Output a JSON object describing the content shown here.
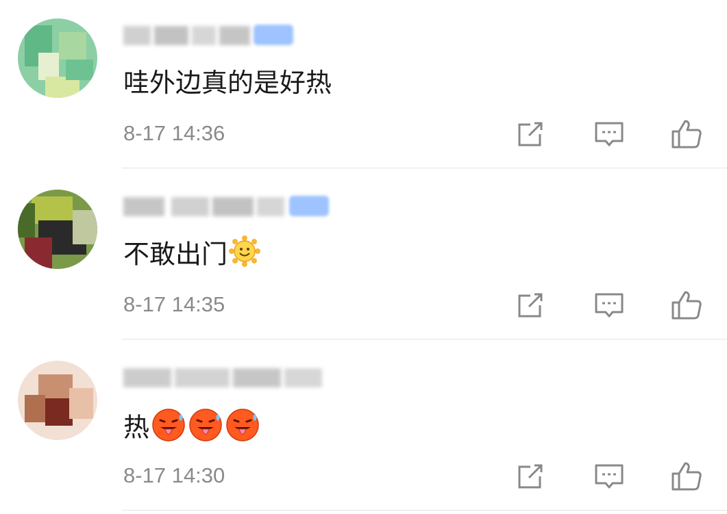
{
  "comments": [
    {
      "text": "哇外边真的是好热",
      "time": "8-17 14:36",
      "emojis": [],
      "avatar_colors": [
        "#7fc79a",
        "#5fb886",
        "#a8d8a0",
        "#d8e8a0",
        "#e6f0d0"
      ]
    },
    {
      "text": "不敢出门",
      "time": "8-17 14:35",
      "emojis": [
        "smiling-sun"
      ],
      "avatar_colors": [
        "#6a8a3a",
        "#2a2a2a",
        "#8a2a30",
        "#c0c8a0",
        "#4a6a2a"
      ]
    },
    {
      "text": "热",
      "time": "8-17 14:30",
      "emojis": [
        "hot-face",
        "hot-face",
        "hot-face"
      ],
      "avatar_colors": [
        "#f2d8c8",
        "#c89070",
        "#7a2a20",
        "#e8c0a8",
        "#b07050"
      ]
    }
  ],
  "colors": {
    "text": "#1a1a1a",
    "time": "#8a8a8a",
    "icon": "#888888",
    "divider": "#e3e3e3",
    "badge": "#9ec3ff"
  }
}
